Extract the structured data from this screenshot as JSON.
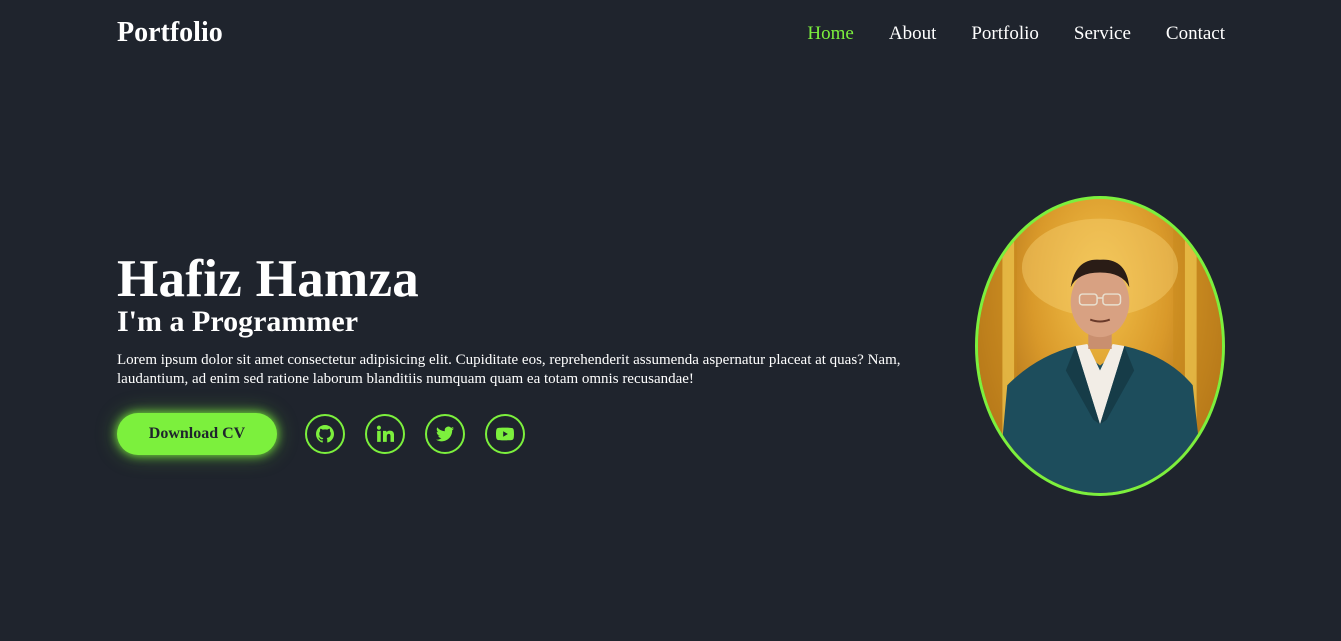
{
  "header": {
    "logo": "Portfolio",
    "nav": [
      {
        "label": "Home",
        "active": true
      },
      {
        "label": "About",
        "active": false
      },
      {
        "label": "Portfolio",
        "active": false
      },
      {
        "label": "Service",
        "active": false
      },
      {
        "label": "Contact",
        "active": false
      }
    ]
  },
  "home": {
    "name": "Hafiz Hamza",
    "subtitle": "I'm a Programmer",
    "description": "Lorem ipsum dolor sit amet consectetur adipisicing elit. Cupiditate eos, reprehenderit assumenda aspernatur placeat at quas? Nam, laudantium, ad enim sed ratione laborum blanditiis numquam quam ea totam omnis recusandae!",
    "cta_label": "Download CV",
    "socials": [
      {
        "icon": "github-icon"
      },
      {
        "icon": "linkedin-icon"
      },
      {
        "icon": "twitter-icon"
      },
      {
        "icon": "youtube-icon"
      }
    ]
  },
  "colors": {
    "background": "#1f242d",
    "accent": "#7cf03d",
    "text": "#ffffff"
  }
}
